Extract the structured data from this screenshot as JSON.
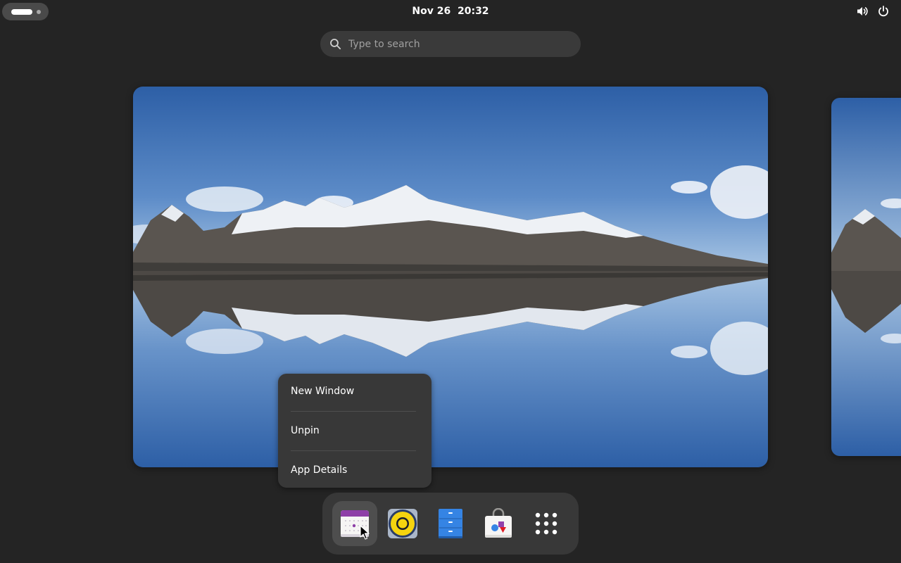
{
  "topbar": {
    "clock": "Nov 26  20:32",
    "icons": [
      "activities-indicator",
      "volume-icon",
      "power-icon"
    ]
  },
  "search": {
    "placeholder": "Type to search",
    "value": ""
  },
  "workspaces": [
    {
      "name": "workspace-current",
      "content": "mountain-lake-wallpaper"
    },
    {
      "name": "workspace-next",
      "content": "mountain-lake-wallpaper"
    }
  ],
  "context_menu": {
    "items": [
      {
        "label": "New Window"
      },
      {
        "label": "Unpin"
      },
      {
        "label": "App Details"
      }
    ]
  },
  "dash": {
    "apps": [
      {
        "icon": "calendar-icon",
        "active": true
      },
      {
        "icon": "rhythmbox-speaker-icon",
        "active": false
      },
      {
        "icon": "file-cabinet-icon",
        "active": false
      },
      {
        "icon": "software-store-icon",
        "active": false
      },
      {
        "icon": "app-grid-icon",
        "active": false
      }
    ]
  },
  "colors": {
    "background": "#242424",
    "panel": "#383838",
    "search_field": "#3a3a3a",
    "accent_purple": "#8e3fa7",
    "accent_blue": "#3584e4",
    "accent_yellow": "#f5d40f"
  }
}
